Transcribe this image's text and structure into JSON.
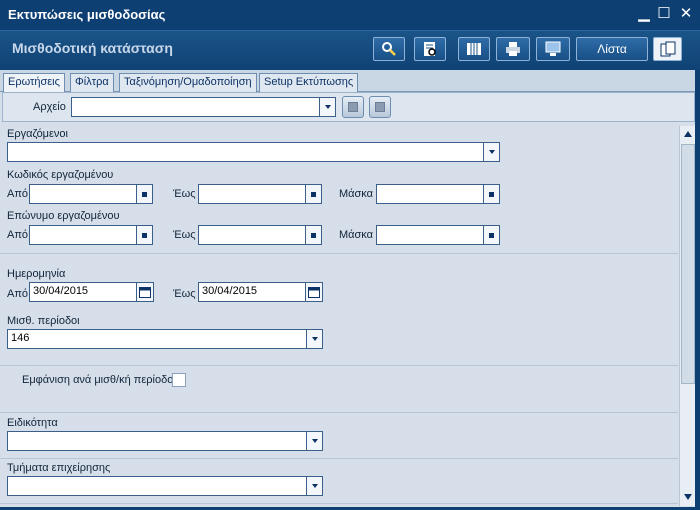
{
  "window": {
    "title": "Εκτυπώσεις μισθοδοσίας",
    "minimize_glyph": "▁",
    "maximize_glyph": "☐",
    "close_glyph": "✕"
  },
  "header": {
    "subtitle": "Μισθοδοτική κατάσταση",
    "toolbar": {
      "icons": [
        "search-icon",
        "preview-icon",
        "columns-icon",
        "print-icon",
        "export-icon",
        "copy-icon"
      ],
      "list_label": "Λίστα"
    }
  },
  "tabs": [
    {
      "label": "Ερωτήσεις",
      "active": true
    },
    {
      "label": "Φίλτρα",
      "active": false
    },
    {
      "label": "Ταξινόμηση/Ομαδοποίηση",
      "active": false
    },
    {
      "label": "Setup Εκτύπωσης",
      "active": false
    }
  ],
  "file": {
    "label": "Αρχείο",
    "value": ""
  },
  "form": {
    "employees": {
      "label": "Εργαζόμενοι",
      "value": ""
    },
    "employee_code": {
      "label": "Κωδικός εργαζομένου",
      "from_label": "Από",
      "to_label": "Έως",
      "mask_label": "Μάσκα",
      "from_value": "",
      "to_value": "",
      "mask_value": ""
    },
    "employee_surname": {
      "label": "Επώνυμο εργαζομένου",
      "from_label": "Από",
      "to_label": "Έως",
      "mask_label": "Μάσκα",
      "from_value": "",
      "to_value": "",
      "mask_value": ""
    },
    "date": {
      "label": "Ημερομηνία",
      "from_label": "Από",
      "to_label": "Έως",
      "from_value": "30/04/2015",
      "to_value": "30/04/2015"
    },
    "payroll_period": {
      "label": "Μισθ. περίοδοι",
      "value": "146"
    },
    "show_per_period": {
      "label": "Εμφάνιση ανά μισθ/κή περίοδο",
      "checked": false
    },
    "specialty": {
      "label": "Ειδικότητα",
      "value": ""
    },
    "departments": {
      "label": "Τμήματα επιχείρησης",
      "value": ""
    }
  },
  "colors": {
    "titlebar": "#0d3f73",
    "header": "#1b5488",
    "panel": "#d6dfe9",
    "field_border": "#3a5f8a"
  }
}
